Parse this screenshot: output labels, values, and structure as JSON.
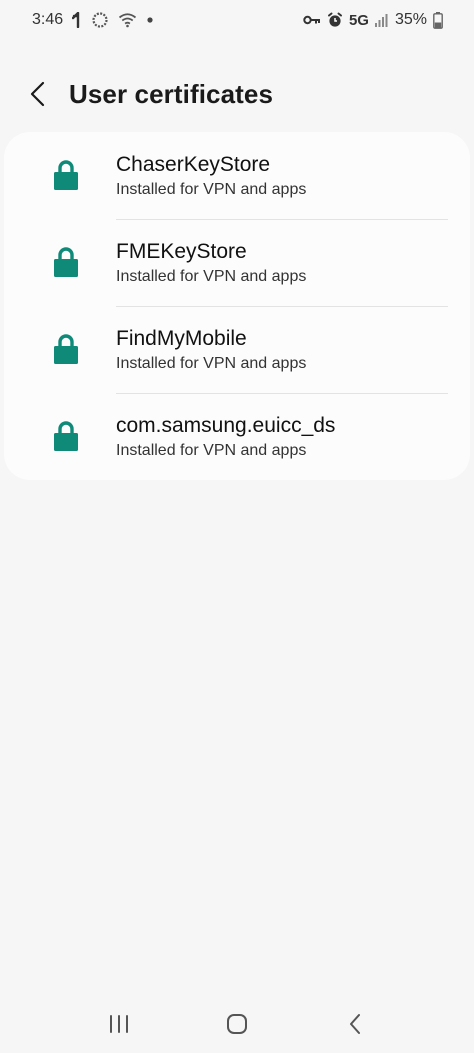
{
  "status_bar": {
    "time": "3:46",
    "network": "5G",
    "battery": "35%",
    "icons": [
      "notification-icon",
      "sync-icon",
      "wifi-icon",
      "dot-icon",
      "vpn-key-icon",
      "alarm-icon",
      "signal-icon",
      "battery-icon"
    ]
  },
  "header": {
    "title": "User certificates",
    "back_icon": "chevron-left-icon"
  },
  "certificates": [
    {
      "name": "ChaserKeyStore",
      "subtitle": "Installed for VPN and apps",
      "icon": "lock-icon"
    },
    {
      "name": "FMEKeyStore",
      "subtitle": "Installed for VPN and apps",
      "icon": "lock-icon"
    },
    {
      "name": "FindMyMobile",
      "subtitle": "Installed for VPN and apps",
      "icon": "lock-icon"
    },
    {
      "name": "com.samsung.euicc_ds",
      "subtitle": "Installed for VPN and apps",
      "icon": "lock-icon"
    }
  ],
  "nav_bar": {
    "buttons": [
      "recents-icon",
      "home-icon",
      "back-icon"
    ]
  },
  "colors": {
    "accent": "#0f8a78",
    "background": "#f6f6f6",
    "card": "#fcfcfc"
  }
}
